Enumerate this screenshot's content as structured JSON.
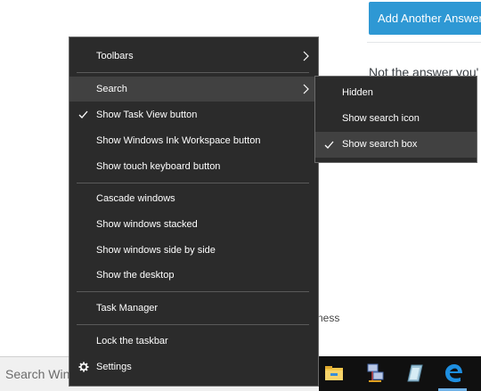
{
  "page": {
    "answer_button": "Add Another Answer",
    "not_answer_text": "Not the answer you'",
    "fragment_text": "ness"
  },
  "context_menu": {
    "toolbars": "Toolbars",
    "search": "Search",
    "show_task_view": "Show Task View button",
    "show_ink_workspace": "Show Windows Ink Workspace button",
    "show_touch_keyboard": "Show touch keyboard button",
    "cascade_windows": "Cascade windows",
    "show_windows_stacked": "Show windows stacked",
    "show_side_by_side": "Show windows side by side",
    "show_desktop": "Show the desktop",
    "task_manager": "Task Manager",
    "lock_taskbar": "Lock the taskbar",
    "settings": "Settings",
    "checked": [
      "Show Task View button"
    ]
  },
  "search_submenu": {
    "hidden": "Hidden",
    "show_search_icon": "Show search icon",
    "show_search_box": "Show search box",
    "selected": "Show search box"
  },
  "taskbar": {
    "search_placeholder": "Search Windows",
    "pinned_icons": [
      "file-explorer-icon",
      "network-icon",
      "sticky-notes-icon",
      "edge-icon"
    ],
    "active_app": "edge-icon"
  },
  "colors": {
    "menu_bg": "#2b2b2b",
    "menu_highlight": "#414141",
    "accent_button": "#2e98d4",
    "taskbar_bg": "#101010"
  }
}
